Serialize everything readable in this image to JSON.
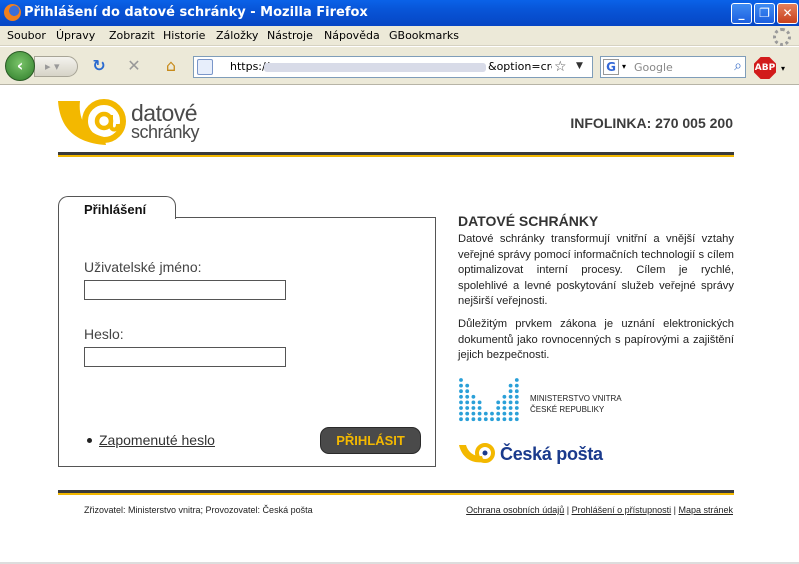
{
  "window": {
    "title": "Přihlášení do datové schránky - Mozilla Firefox",
    "buttons": {
      "minimize": "_",
      "maximize": "❐",
      "close": "✕"
    }
  },
  "menu": {
    "items": [
      "Soubor",
      "Úpravy",
      "Zobrazit",
      "Historie",
      "Záložky",
      "Nástroje",
      "Nápověda",
      "GBookmarks"
    ]
  },
  "toolbar": {
    "url_prefix": "https://",
    "url_suffix": "&option=cre",
    "search_placeholder": "Google",
    "adblock_label": "ABP"
  },
  "header": {
    "logo_line1": "datové",
    "logo_line2": "schránky",
    "infolinka": "INFOLINKA: 270 005 200"
  },
  "login": {
    "tab_label": "Přihlášení",
    "username_label": "Uživatelské jméno:",
    "username_value": "",
    "password_label": "Heslo:",
    "password_value": "",
    "forgot_link": "Zapomenuté heslo",
    "submit_label": "PŘIHLÁSIT"
  },
  "sidebar": {
    "title": "DATOVÉ SCHRÁNKY",
    "paragraph1": "Datové schránky transformují vnitřní a vnější vztahy veřejné správy pomocí informačních technologií s cílem optimalizovat interní procesy. Cílem je rychlé, spolehlivé a levné poskytování služeb veřejné správy nejširší veřejnosti.",
    "paragraph2": "Důležitým prvkem zákona je uznání elektronických dokumentů jako rovnocenných s papírovými a zajištění jejich bezpečnosti.",
    "mv_line1": "MINISTERSTVO VNITRA",
    "mv_line2": "ČESKÉ REPUBLIKY",
    "cp_name": "Česká pošta"
  },
  "footer": {
    "left": "Zřizovatel: Ministerstvo vnitra; Provozovatel: Česká pošta",
    "links": [
      "Ochrana osobních údajů",
      "Prohlášení o přístupnosti",
      "Mapa stránek"
    ],
    "separator": " | "
  },
  "colors": {
    "gold": "#f3b800",
    "dark": "#3b3b3b",
    "posta_blue": "#1a3a8c",
    "mv_blue": "#2aa0d8"
  }
}
